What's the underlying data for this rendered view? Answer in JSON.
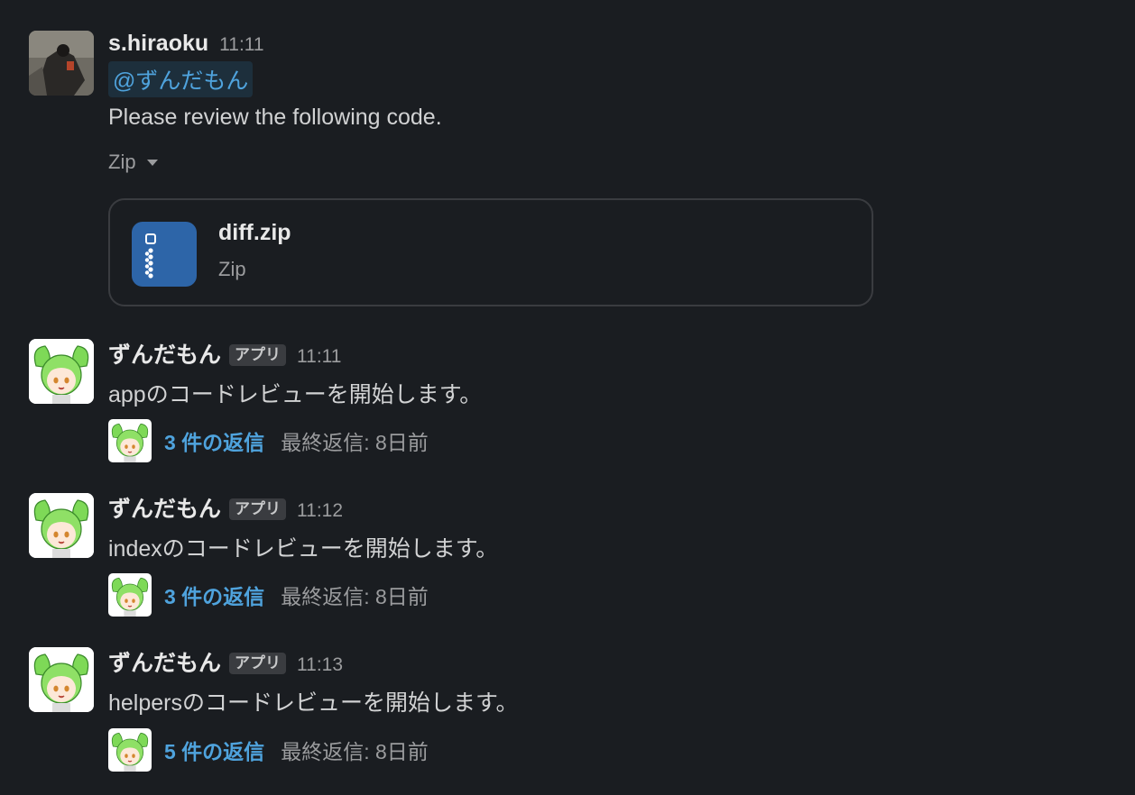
{
  "messages": [
    {
      "author": "s.hiraoku",
      "time": "11:11",
      "mention": "@ずんだもん",
      "text": "Please review the following code.",
      "file_toggle": "Zip",
      "file": {
        "name": "diff.zip",
        "type": "Zip",
        "icon": "zip-file-icon"
      }
    },
    {
      "author": "ずんだもん",
      "badge": "アプリ",
      "time": "11:11",
      "text": "appのコードレビューを開始します。",
      "thread": {
        "count": "3 件の返信",
        "last": "最終返信: 8日前"
      }
    },
    {
      "author": "ずんだもん",
      "badge": "アプリ",
      "time": "11:12",
      "text": "indexのコードレビューを開始します。",
      "thread": {
        "count": "3 件の返信",
        "last": "最終返信: 8日前"
      }
    },
    {
      "author": "ずんだもん",
      "badge": "アプリ",
      "time": "11:13",
      "text": "helpersのコードレビューを開始します。",
      "thread": {
        "count": "5 件の返信",
        "last": "最終返信: 8日前"
      }
    }
  ],
  "colors": {
    "background": "#1a1d21",
    "link": "#4fa3dd",
    "zip_icon": "#2d65a8"
  }
}
